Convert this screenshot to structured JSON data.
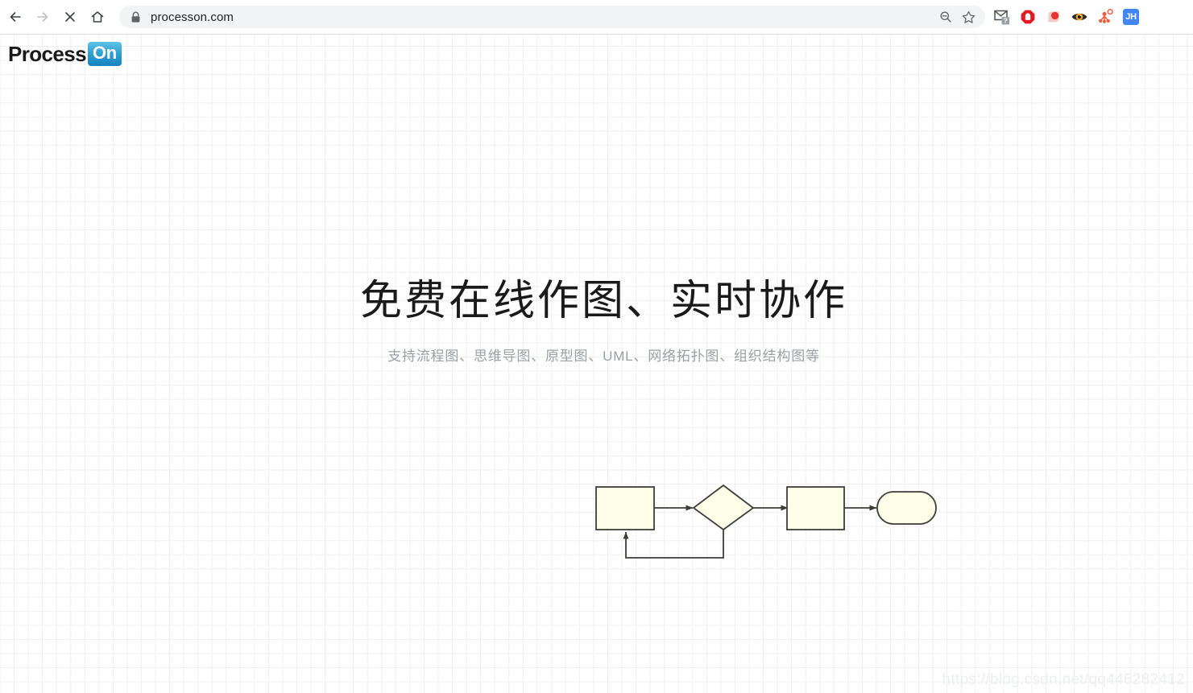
{
  "browser": {
    "back_label": "Back",
    "forward_label": "Forward",
    "stop_label": "Stop",
    "home_label": "Home",
    "url": "processon.com",
    "lock_icon": "lock-icon",
    "zoom_out_icon": "zoom-out-icon",
    "bookmark_icon": "star-outline-icon",
    "extensions": [
      {
        "name": "gmail-checker-icon",
        "title": "Gmail"
      },
      {
        "name": "adblock-icon",
        "title": "AdBlock"
      },
      {
        "name": "red-blob-extension-icon",
        "title": "Extension"
      },
      {
        "name": "eye-tracking-icon",
        "title": "Eye"
      },
      {
        "name": "node-graph-extension-icon",
        "title": "Graph"
      }
    ],
    "profile_initials": "JH"
  },
  "site": {
    "logo_primary": "Process",
    "logo_accent": "On",
    "logo_accent_color": "#1682c0"
  },
  "hero": {
    "title": "免费在线作图、实时协作",
    "subtitle": "支持流程图、思维导图、原型图、UML、网络拓扑图、组织结构图等"
  },
  "diagram": {
    "name": "flowchart-illustration",
    "shape_fill": "#fdfde8",
    "shape_stroke": "#3d3d3a",
    "nodes": [
      {
        "name": "process-node-1",
        "type": "rectangle",
        "label": ""
      },
      {
        "name": "decision-node",
        "type": "diamond",
        "label": ""
      },
      {
        "name": "process-node-2",
        "type": "rectangle",
        "label": ""
      },
      {
        "name": "terminator-node",
        "type": "rounded-rectangle",
        "label": ""
      }
    ],
    "connectors": [
      {
        "name": "connector-1",
        "from": "process-node-1",
        "to": "decision-node"
      },
      {
        "name": "connector-2",
        "from": "decision-node",
        "to": "process-node-2"
      },
      {
        "name": "connector-3",
        "from": "process-node-2",
        "to": "terminator-node"
      },
      {
        "name": "feedback-loop",
        "from": "decision-node",
        "to": "process-node-1"
      }
    ]
  },
  "watermark": {
    "text": "https://blog.csdn.net/qq446282412"
  }
}
